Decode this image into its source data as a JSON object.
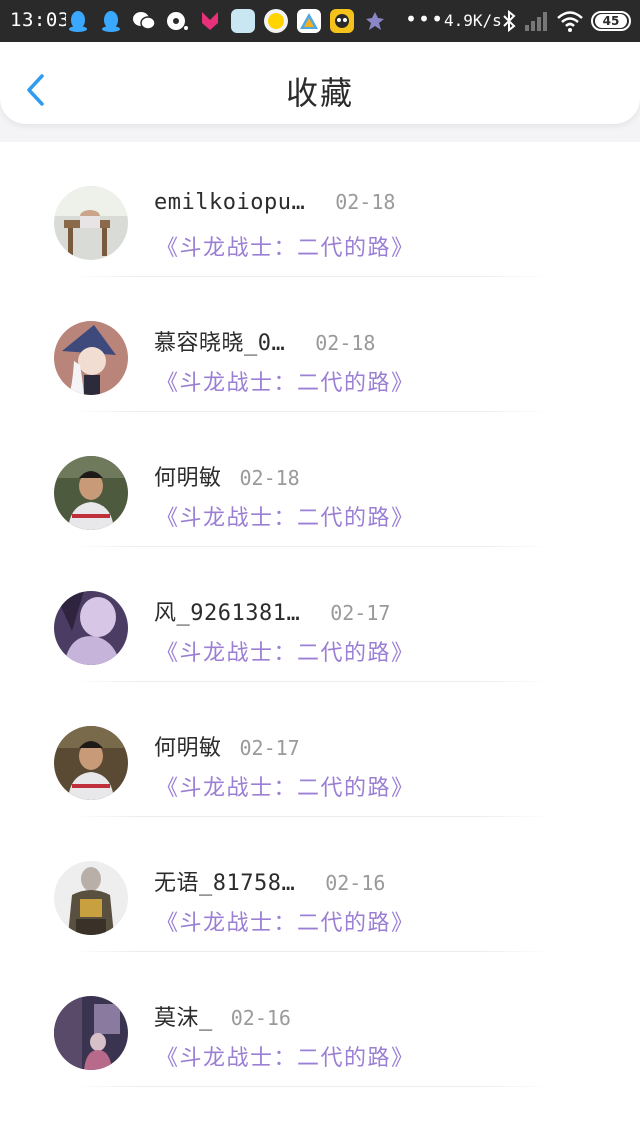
{
  "status_bar": {
    "time": "13:03",
    "dots": "•••",
    "net_speed": "4.9K/s",
    "battery": "45",
    "app_icons": [
      "qq-icon",
      "qq-icon",
      "wechat-icon",
      "music-icon",
      "youku-icon",
      "app-icon",
      "app-icon",
      "drive-icon",
      "game-icon",
      "app-icon"
    ]
  },
  "header": {
    "title": "收藏",
    "back_icon": "chevron-left-icon",
    "accent_color": "#2f9cf0"
  },
  "favorites": [
    {
      "name": "emilkoiopu…",
      "date": "02-18",
      "book": "《斗龙战士：二代的路》",
      "avatar": "girl-at-desk"
    },
    {
      "name": "慕容晓晓_0…",
      "date": "02-18",
      "book": "《斗龙战士：二代的路》",
      "avatar": "anime-witch"
    },
    {
      "name": "何明敏",
      "date": "02-18",
      "book": "《斗龙战士：二代的路》",
      "avatar": "person-photo"
    },
    {
      "name": "风_9261381…",
      "date": "02-17",
      "book": "《斗龙战士：二代的路》",
      "avatar": "purple-portrait"
    },
    {
      "name": "何明敏",
      "date": "02-17",
      "book": "《斗龙战士：二代的路》",
      "avatar": "person-photo"
    },
    {
      "name": "无语_81758…",
      "date": "02-16",
      "book": "《斗龙战士：二代的路》",
      "avatar": "cosplay-figure"
    },
    {
      "name": "莫沫_",
      "date": "02-16",
      "book": "《斗龙战士：二代的路》",
      "avatar": "room-scene"
    }
  ],
  "colors": {
    "book_title": "#9b7fd4",
    "name": "#2c2c2c",
    "date": "#9a9a9a",
    "status_bar": "#2a2a2a"
  }
}
